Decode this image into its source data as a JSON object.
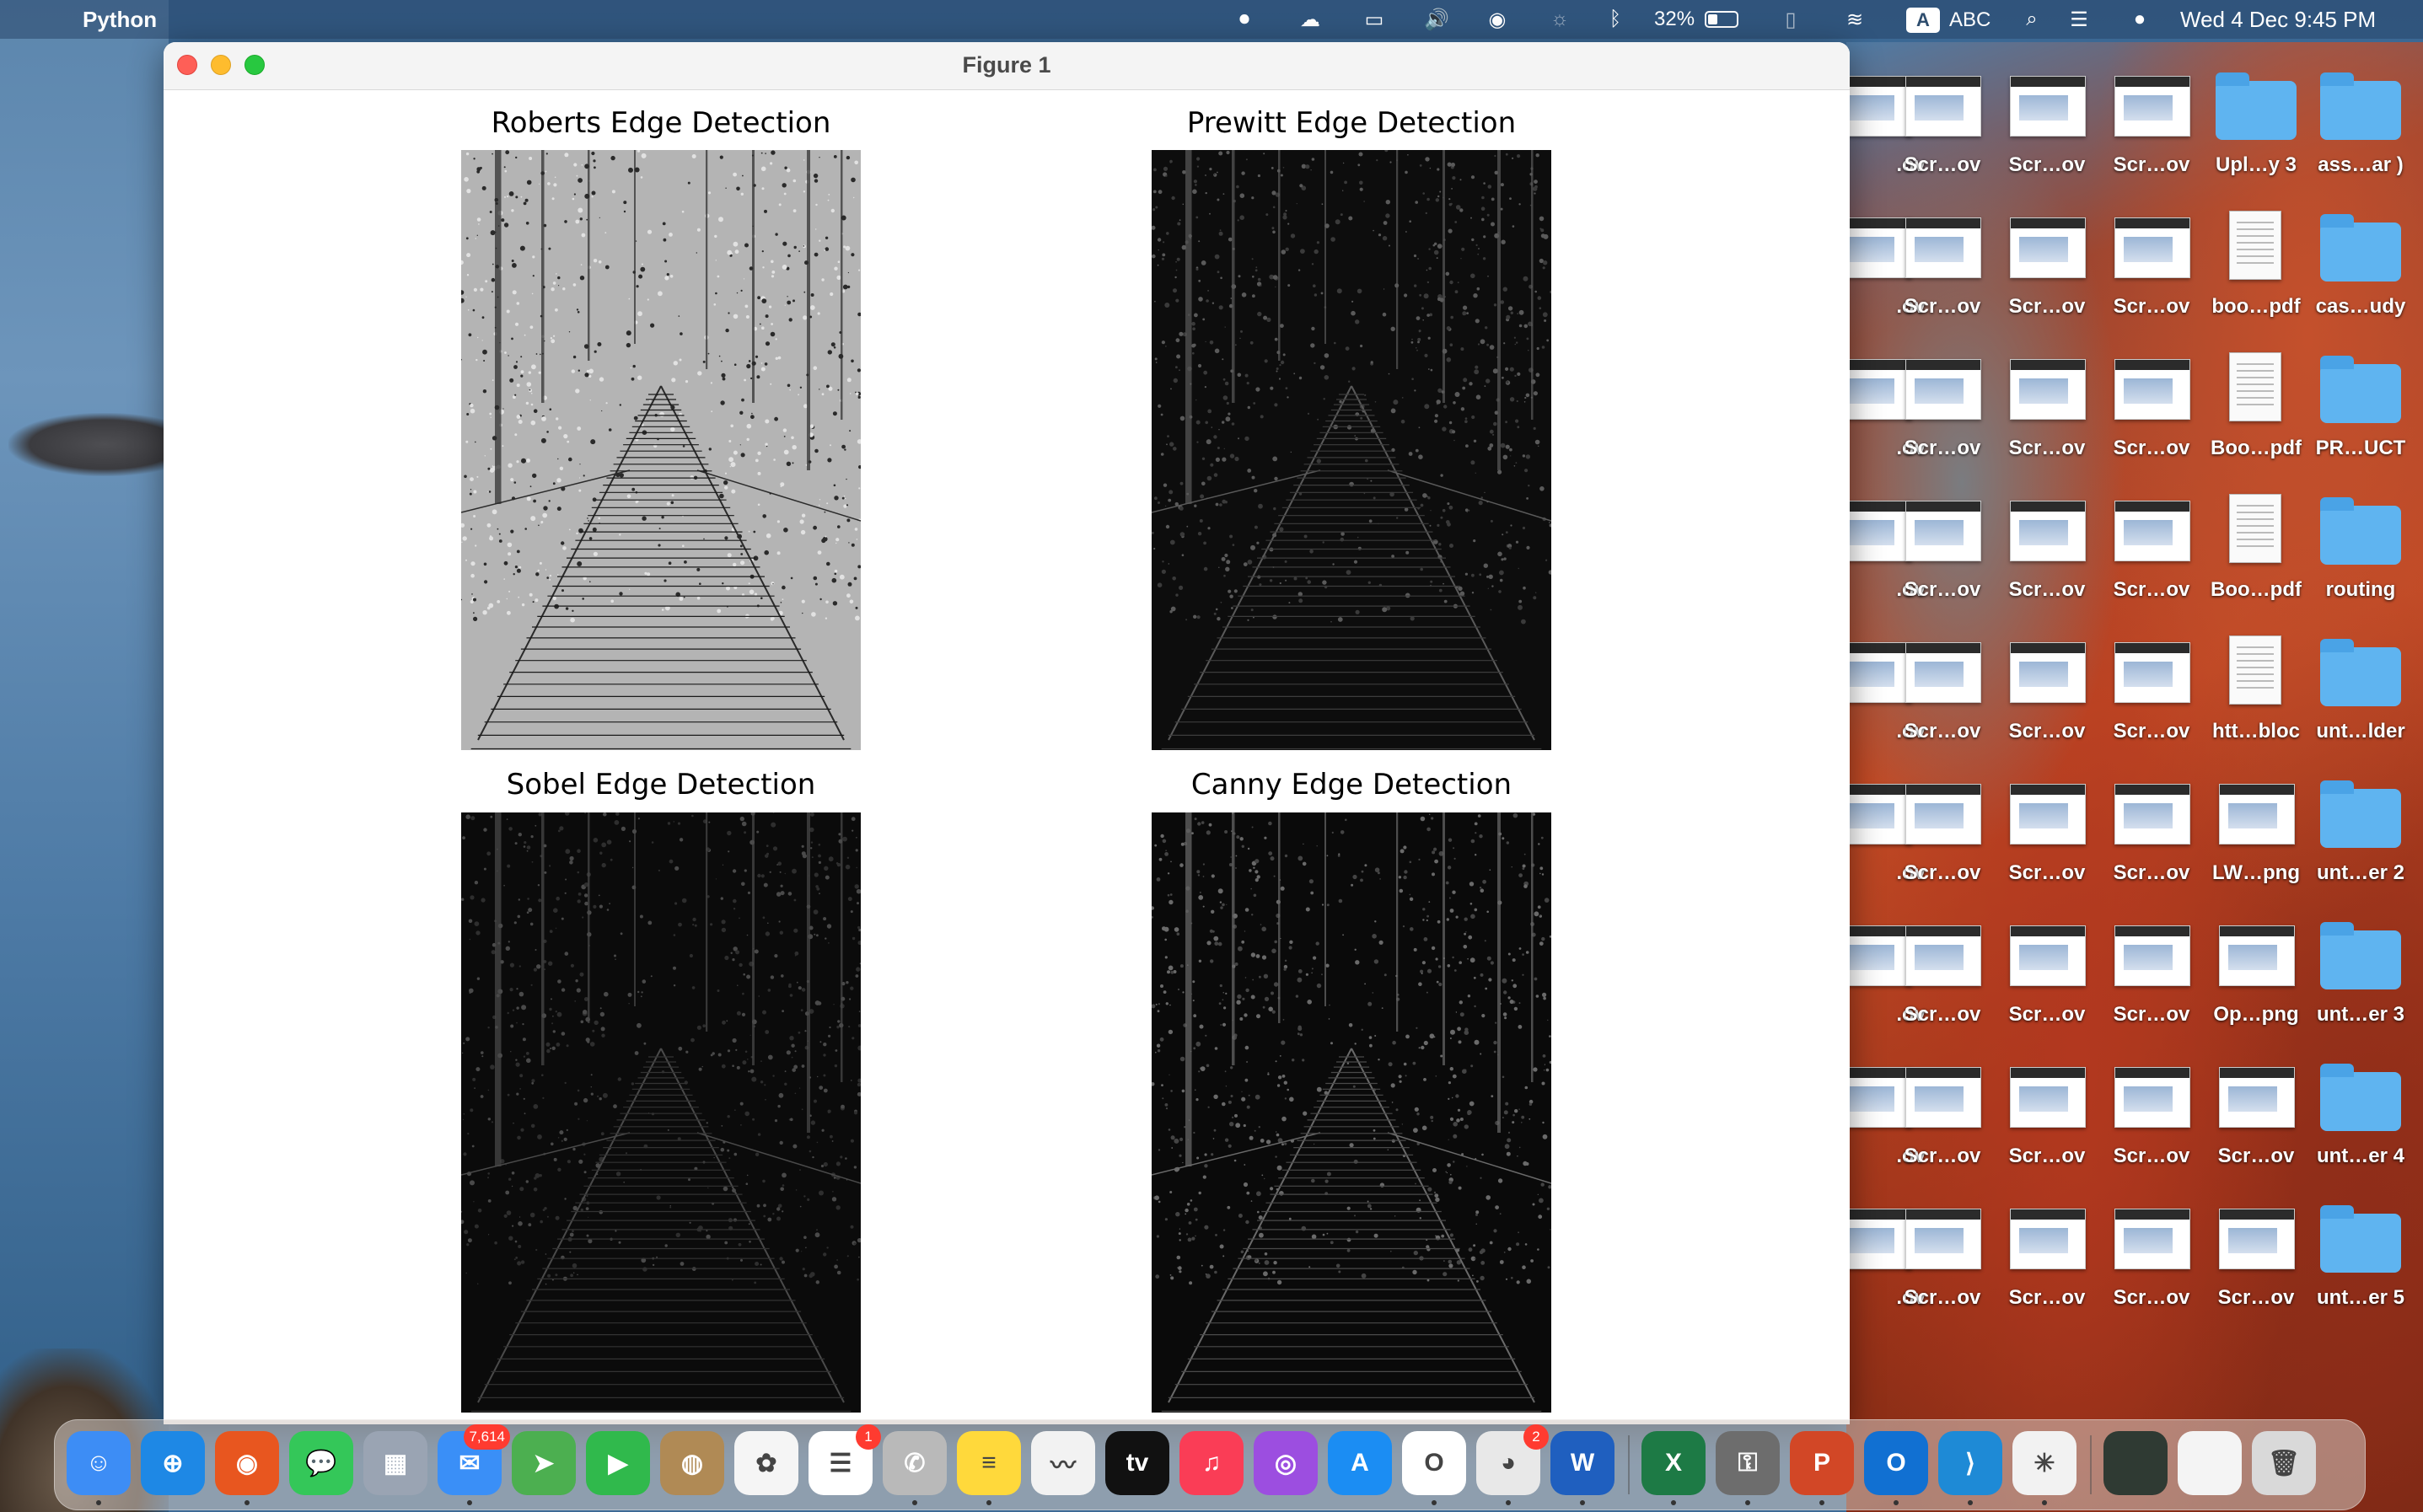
{
  "menubar": {
    "app_name": "Python",
    "battery_percent": "32%",
    "input_source_badge": "A",
    "input_source_label": "ABC",
    "clock": "Wed 4 Dec  9:45 PM"
  },
  "window": {
    "title": "Figure 1",
    "panels": [
      {
        "title": "Roberts Edge Detection",
        "style": "roberts"
      },
      {
        "title": "Prewitt Edge Detection",
        "style": "prewitt"
      },
      {
        "title": "Sobel Edge Detection",
        "style": "sobel"
      },
      {
        "title": "Canny Edge Detection",
        "style": "canny"
      }
    ]
  },
  "desktop": {
    "columns": [
      {
        "labels": [
          ".ov",
          ".ov",
          ".ov",
          ".ov",
          ".ov",
          ".ov",
          ".ov",
          ".ov",
          ".ov"
        ],
        "kind": "partial"
      },
      {
        "labels": [
          "Scr…ov",
          "Scr…ov",
          "Scr…ov",
          "Scr…ov",
          "Scr…ov",
          "Scr…ov",
          "Scr…ov",
          "Scr…ov",
          "Scr…ov"
        ],
        "kind": "screenshot"
      },
      {
        "labels": [
          "Scr…ov",
          "Scr…ov",
          "Scr…ov",
          "Scr…ov",
          "Scr…ov",
          "Scr…ov",
          "Scr…ov",
          "Scr…ov",
          "Scr…ov"
        ],
        "kind": "screenshot"
      },
      {
        "labels": [
          "Scr…ov",
          "Scr…ov",
          "Scr…ov",
          "Scr…ov",
          "Scr…ov",
          "Scr…ov",
          "Scr…ov",
          "Scr…ov",
          "Scr…ov"
        ],
        "kind": "screenshot"
      },
      {
        "labels": [
          "Upl…y 3",
          "boo…pdf",
          "Boo…pdf",
          "Boo…pdf",
          "htt…bloc",
          "LW…png",
          "Op…png",
          "Scr…ov",
          "Scr…ov"
        ],
        "kind": "mixed"
      },
      {
        "labels": [
          "ass…ar )",
          "cas…udy",
          "PR…UCT",
          "routing",
          "unt…lder",
          "unt…er 2",
          "unt…er 3",
          "unt…er 4",
          "unt…er 5"
        ],
        "kind": "folder"
      }
    ]
  },
  "dock": {
    "apps": [
      {
        "name": "Finder",
        "icon": "finder-icon",
        "color": "#3d8df5",
        "glyph": "☺",
        "running": true
      },
      {
        "name": "Safari",
        "icon": "safari-icon",
        "color": "#1e88e5",
        "glyph": "⊕",
        "running": false
      },
      {
        "name": "Firefox",
        "icon": "firefox-icon",
        "color": "#e8561f",
        "glyph": "◉",
        "running": true
      },
      {
        "name": "Messages",
        "icon": "messages-icon",
        "color": "#34c759",
        "glyph": "💬",
        "running": false
      },
      {
        "name": "Launchpad",
        "icon": "launchpad-icon",
        "color": "#9aa4b3",
        "glyph": "▦",
        "running": false
      },
      {
        "name": "Mail",
        "icon": "mail-icon",
        "color": "#3a8ff7",
        "glyph": "✉",
        "running": true,
        "badge": "7,614"
      },
      {
        "name": "Maps",
        "icon": "maps-icon",
        "color": "#4caf50",
        "glyph": "➤",
        "running": false
      },
      {
        "name": "FaceTime",
        "icon": "facetime-icon",
        "color": "#30b94c",
        "glyph": "▶",
        "running": false
      },
      {
        "name": "Contacts",
        "icon": "contacts-icon",
        "color": "#b08a55",
        "glyph": "◍",
        "running": false
      },
      {
        "name": "Photos",
        "icon": "photos-icon",
        "color": "#f5f5f5",
        "glyph": "✿",
        "running": false
      },
      {
        "name": "Reminders",
        "icon": "reminders-icon",
        "color": "#ffffff",
        "glyph": "☰",
        "running": false,
        "badge": "1"
      },
      {
        "name": "WhatsApp",
        "icon": "whatsapp-icon",
        "color": "#b9b9b9",
        "glyph": "✆",
        "running": true
      },
      {
        "name": "Notes",
        "icon": "notes-icon",
        "color": "#ffd93b",
        "glyph": "≡",
        "running": true
      },
      {
        "name": "Freeform",
        "icon": "freeform-icon",
        "color": "#f2f2f2",
        "glyph": "〰",
        "running": false
      },
      {
        "name": "Apple TV",
        "icon": "appletv-icon",
        "color": "#111111",
        "glyph": "tv",
        "running": false
      },
      {
        "name": "Music",
        "icon": "music-icon",
        "color": "#fa3d56",
        "glyph": "♫",
        "running": false
      },
      {
        "name": "Podcasts",
        "icon": "podcasts-icon",
        "color": "#9c4ee0",
        "glyph": "◎",
        "running": false
      },
      {
        "name": "App Store",
        "icon": "appstore-icon",
        "color": "#1b8df3",
        "glyph": "A",
        "running": false
      },
      {
        "name": "Opera",
        "icon": "opera-icon",
        "color": "#ffffff",
        "glyph": "O",
        "running": true
      },
      {
        "name": "Chrome",
        "icon": "chrome-icon",
        "color": "#e8e8e8",
        "glyph": "◕",
        "running": true,
        "badge": "2"
      },
      {
        "name": "Word",
        "icon": "word-icon",
        "color": "#1f5fbf",
        "glyph": "W",
        "running": true
      },
      {
        "name": "Excel",
        "icon": "excel-icon",
        "color": "#1d7a45",
        "glyph": "X",
        "running": true
      },
      {
        "name": "Keychain Access",
        "icon": "keychain-icon",
        "color": "#6d6d6d",
        "glyph": "⚿",
        "running": true
      },
      {
        "name": "PowerPoint",
        "icon": "powerpoint-icon",
        "color": "#d24726",
        "glyph": "P",
        "running": true
      },
      {
        "name": "Outlook",
        "icon": "outlook-icon",
        "color": "#1170d2",
        "glyph": "O",
        "running": true
      },
      {
        "name": "VS Code",
        "icon": "vscode-icon",
        "color": "#1e8ad6",
        "glyph": "⟩",
        "running": true
      },
      {
        "name": "Python",
        "icon": "python-launcher-icon",
        "color": "#f2f2f2",
        "glyph": "✳",
        "running": true
      },
      {
        "name": "Recent Document 1",
        "icon": "recent-document-icon",
        "color": "#2f3a33",
        "glyph": "",
        "running": false
      },
      {
        "name": "Recent Document 2",
        "icon": "recent-document-icon",
        "color": "#f4f4f4",
        "glyph": "",
        "running": false
      },
      {
        "name": "Trash",
        "icon": "trash-icon",
        "color": "#d9d9d9",
        "glyph": "🗑",
        "running": false
      }
    ]
  }
}
